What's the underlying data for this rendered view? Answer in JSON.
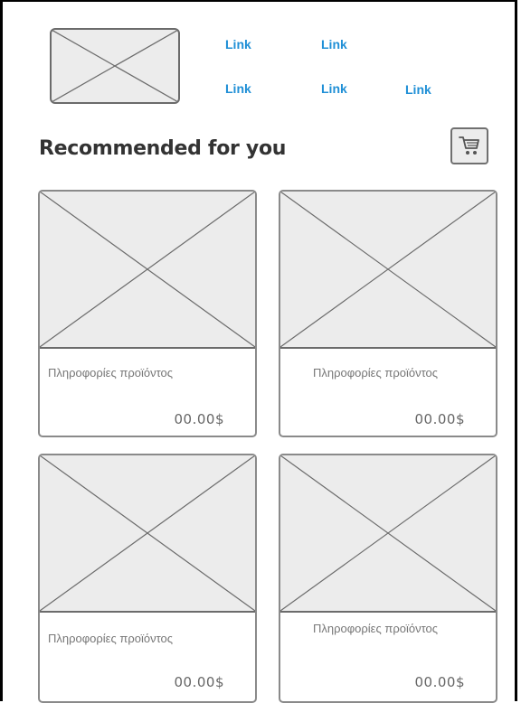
{
  "header": {
    "links": [
      "Link",
      "Link",
      "Link",
      "Link",
      "Link"
    ]
  },
  "section": {
    "title": "Recommended for you",
    "cart_icon": "shopping-cart-icon"
  },
  "products": [
    {
      "info": "Πληροφορίες προϊόντος",
      "price": "00.00$"
    },
    {
      "info": "Πληροφορίες προϊόντος",
      "price": "00.00$"
    },
    {
      "info": "Πληροφορίες προϊόντος",
      "price": "00.00$"
    },
    {
      "info": "Πληροφορίες προϊόντος",
      "price": "00.00$"
    }
  ],
  "colors": {
    "link": "#1f8fd6",
    "placeholder_fill": "#ececec",
    "placeholder_stroke": "#6b6b6b"
  }
}
